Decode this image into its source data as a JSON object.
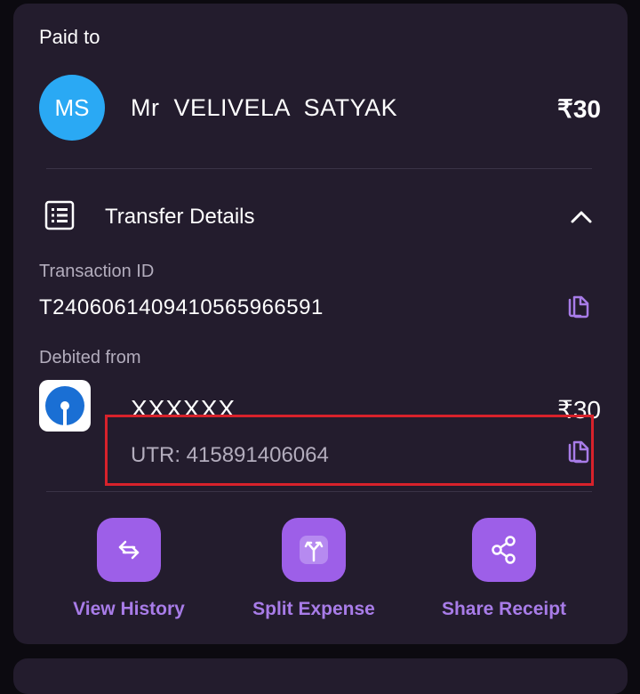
{
  "paid_to_label": "Paid to",
  "payee": {
    "initials": "MS",
    "name": "Mr  VELIVELA  SATYAK",
    "amount": "₹30"
  },
  "transfer_details": {
    "title": "Transfer Details",
    "transaction_id_label": "Transaction ID",
    "transaction_id": "T2406061409410565966591",
    "debited_from_label": "Debited from",
    "account_masked": "XXXXXX",
    "debit_amount": "₹30",
    "utr": "UTR: 415891406064"
  },
  "actions": [
    {
      "label": "View History",
      "icon": "history-icon"
    },
    {
      "label": "Split Expense",
      "icon": "split-icon"
    },
    {
      "label": "Share Receipt",
      "icon": "share-icon"
    }
  ],
  "colors": {
    "card_bg": "#231c2d",
    "accent": "#9d5fe8",
    "avatar": "#2aa9f4",
    "highlight": "#d8222b"
  }
}
